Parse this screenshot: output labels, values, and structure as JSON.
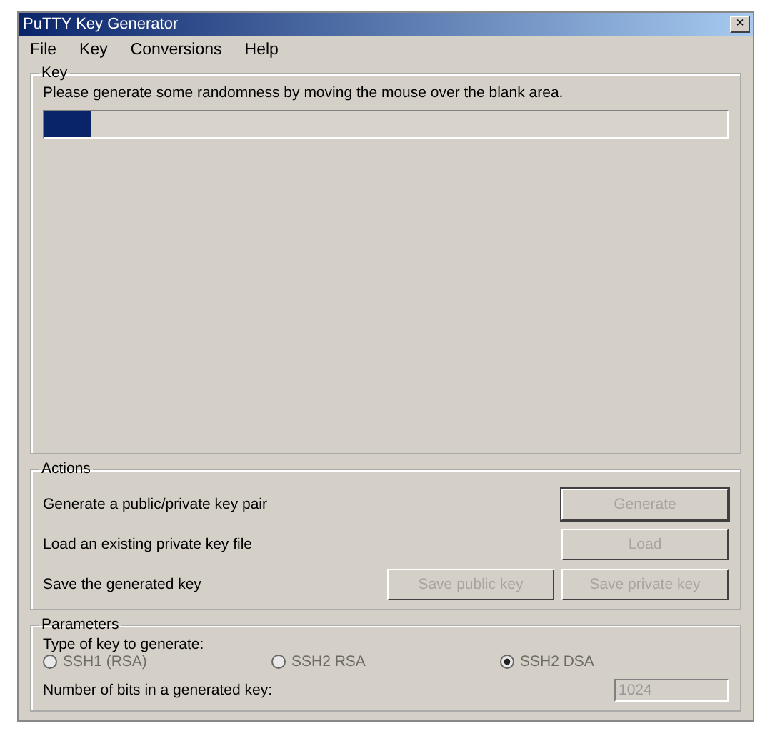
{
  "window": {
    "title": "PuTTY Key Generator",
    "close": "×"
  },
  "menu": [
    "File",
    "Key",
    "Conversions",
    "Help"
  ],
  "key_group": {
    "title": "Key",
    "instruction": "Please generate some randomness by moving the mouse over the blank area.",
    "progress": {
      "level": 0.07
    }
  },
  "actions": {
    "title": "Actions",
    "rows": [
      {
        "label": "Generate a public/private key pair",
        "buttons": [
          {
            "label": "Generate",
            "disabled": true,
            "default": true
          }
        ]
      },
      {
        "label": "Load an existing private key file",
        "buttons": [
          {
            "label": "Load",
            "disabled": true,
            "default": false
          }
        ]
      },
      {
        "label": "Save the generated key",
        "buttons": [
          {
            "label": "Save public key",
            "disabled": true,
            "default": false
          },
          {
            "label": "Save private key",
            "disabled": true,
            "default": false
          }
        ]
      }
    ]
  },
  "parameters": {
    "title": "Parameters",
    "type_label": "Type of key to generate:",
    "key_types": [
      {
        "label": "SSH1 (RSA)",
        "selected": false,
        "disabled": true
      },
      {
        "label": "SSH2 RSA",
        "selected": false,
        "disabled": true
      },
      {
        "label": "SSH2 DSA",
        "selected": true,
        "disabled": true
      }
    ],
    "bits_label": "Number of bits in a generated key:",
    "bits_value": "1024",
    "bits_disabled": true
  }
}
